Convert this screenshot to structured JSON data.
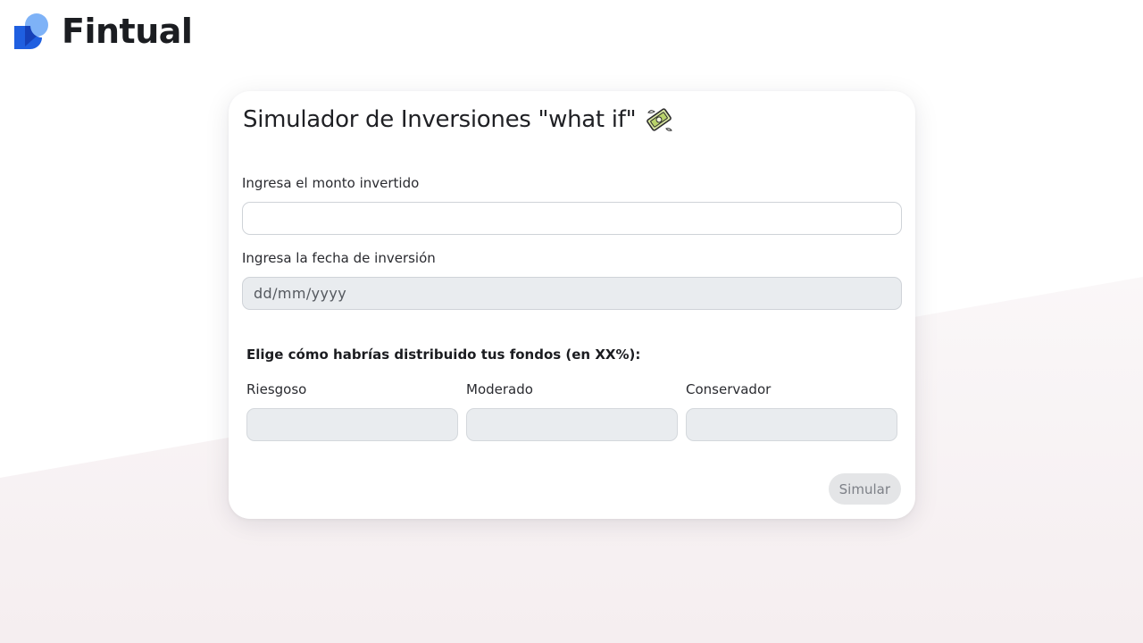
{
  "brand": {
    "name": "Fintual",
    "colors": {
      "light_blue": "#7eb2f7",
      "blue": "#1f5fe0",
      "dark_blue": "#1540b8"
    }
  },
  "simulator": {
    "title": "Simulador de Inversiones \"what if\"",
    "title_icon": "money-with-wings-icon",
    "amount_label": "Ingresa el monto invertido",
    "amount_value": "",
    "date_label": "Ingresa la fecha de inversión",
    "date_placeholder": "dd/mm/yyyy",
    "distribution_heading": "Elige cómo habrías distribuido tus fondos (en XX%):",
    "funds": [
      {
        "label": "Riesgoso",
        "value": ""
      },
      {
        "label": "Moderado",
        "value": ""
      },
      {
        "label": "Conservador",
        "value": ""
      }
    ],
    "submit_label": "Simular"
  },
  "colors": {
    "card_bg": "#ffffff",
    "input_disabled_bg": "#e9ecef",
    "button_bg": "#e4e5e7",
    "button_text": "#7d8087"
  }
}
